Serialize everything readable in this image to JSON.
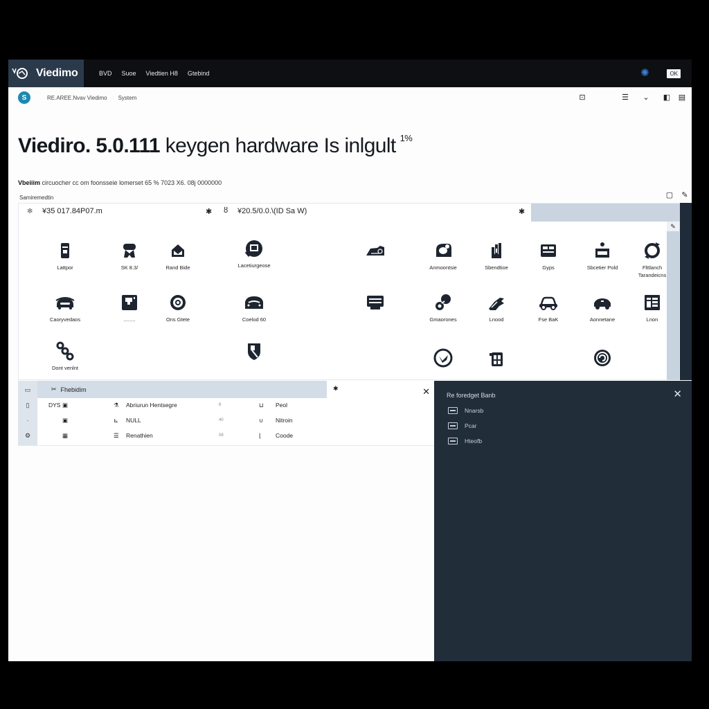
{
  "app": {
    "name": "Viedimo",
    "menu": [
      "BVD",
      "Suoe",
      "Viedtien H8",
      "Gtebind"
    ],
    "ok_label": "OK"
  },
  "breadcrumb": [
    "RE.AREE.Nvav Viedimo",
    "System"
  ],
  "title": {
    "bold": "Viediro. 5.0.111",
    "rest": " keygen hardware Is inlgult",
    "sup": "1%"
  },
  "subtitle": {
    "bold": "Vbeiiim",
    "rest": " circuocher cc om foonsseie lomerset 65 % 7023 X6. 08j 0000000"
  },
  "section_label": "Samiremedtin",
  "panel": {
    "header_left": "¥35 017.84P07.m",
    "header_right": "¥20.5/0.0.\\(ID Sa W)",
    "icons": [
      {
        "id": "laptop",
        "label": "Lattpor"
      },
      {
        "id": "obd",
        "label": "SK 8.3/"
      },
      {
        "id": "envelope",
        "label": "Rand Bide"
      },
      {
        "id": "ecu",
        "label": "Lacetiurgeose"
      },
      {
        "id": "car-side",
        "label": ""
      },
      {
        "id": "accessory",
        "label": "Anmoontsie"
      },
      {
        "id": "tools",
        "label": "Sbendtioe"
      },
      {
        "id": "bus",
        "label": "Gyps"
      },
      {
        "id": "person-desk",
        "label": "Sbcetier Pold"
      },
      {
        "id": "refresh",
        "label": "Flttlanch Tarandeicns"
      },
      {
        "id": "car-front",
        "label": "Caoryvedaos"
      },
      {
        "id": "module",
        "label": "........"
      },
      {
        "id": "target",
        "label": "Ons Gtete"
      },
      {
        "id": "car-top",
        "label": "Coelod 60"
      },
      {
        "id": "printer",
        "label": ""
      },
      {
        "id": "connector",
        "label": "Gmaorones"
      },
      {
        "id": "wrench",
        "label": "Lnood"
      },
      {
        "id": "car-outline",
        "label": "Fse BaK"
      },
      {
        "id": "car-small",
        "label": "Aonnetane"
      },
      {
        "id": "grid-panel",
        "label": "Lnon"
      },
      {
        "id": "chain",
        "label": "Dont venlnt"
      },
      {
        "id": "shield-key",
        "label": ""
      },
      {
        "id": "check-circle",
        "label": ""
      },
      {
        "id": "battery-grid",
        "label": ""
      },
      {
        "id": "spiral",
        "label": ""
      }
    ]
  },
  "lower_list": {
    "header": "Fhebidim",
    "rows": [
      {
        "prefix": "DYS",
        "name": "Abriurun Hentsegre",
        "tag": "8",
        "right": "Peol"
      },
      {
        "prefix": "",
        "name": "NULL",
        "tag": "40",
        "right": "Nitroin"
      },
      {
        "prefix": "",
        "name": "Renathien",
        "tag": "08",
        "right": "Coode"
      }
    ]
  },
  "dark_panel": {
    "title": "Re foredget Banb",
    "items": [
      "Nnarsb",
      "Pcar",
      "Hteofb"
    ]
  }
}
